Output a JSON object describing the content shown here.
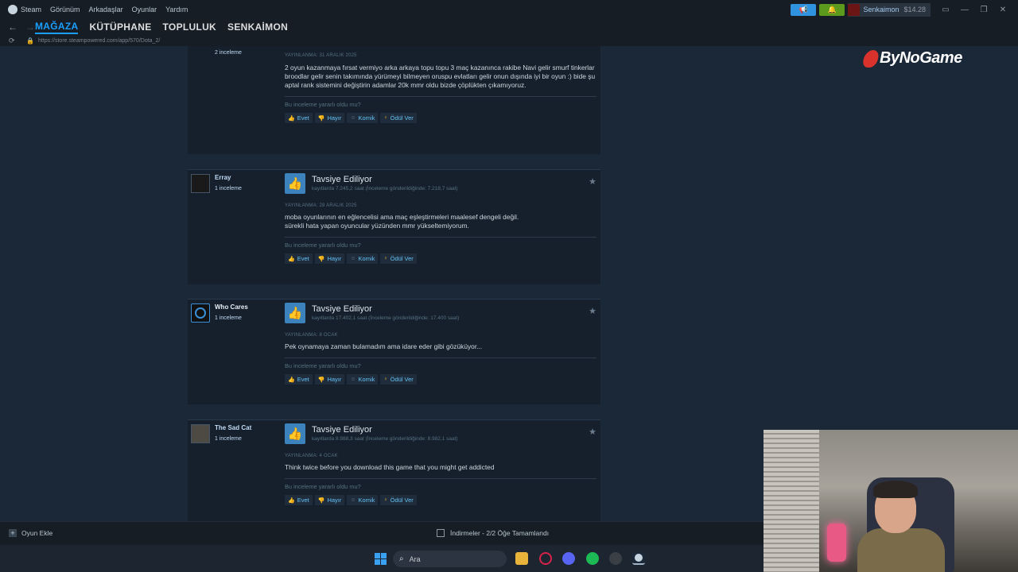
{
  "menu": {
    "items": [
      "Steam",
      "Görünüm",
      "Arkadaşlar",
      "Oyunlar",
      "Yardım"
    ]
  },
  "account": {
    "name": "Senkaimon",
    "balance": "$14.28"
  },
  "nav": {
    "tabs": [
      "MAĞAZA",
      "KÜTÜPHANE",
      "TOPLULUK",
      "SENKAİMON"
    ],
    "url": "https://store.steampowered.com/app/570/Dota_2/"
  },
  "brand": {
    "logo_text": "ByNoGame"
  },
  "reviews": [
    {
      "author": "",
      "count": "2 inceleme",
      "title": "",
      "hours": "",
      "posted": "YAYINLANMA: 31 ARALIK 2025",
      "text": "2 oyun kazanmaya fırsat vermiyo arka arkaya topu topu 3 maç kazanınca rakibe Navi gelir smurf tinkerlar broodlar gelir senin takımında yürümeyi bilmeyen oruspu evlatları gelir onun dışında iyi bir oyun :) bide şu aptal rank sistemini değiştirin adamlar 20k mmr oldu bizde çöplükten çıkamıyoruz."
    },
    {
      "author": "Erray",
      "count": "1 inceleme",
      "title": "Tavsiye Ediliyor",
      "hours": "kayıtlarda 7.245,2 saat (İnceleme gönderildiğinde: 7.218,7 saat)",
      "posted": "YAYINLANMA: 28 ARALIK 2025",
      "text": "moba oyunlarının en eğlencelisi ama maç eşleştirmeleri maalesef dengeli değil.\nsürekli hata yapan oyuncular yüzünden mmr yükseltemiyorum."
    },
    {
      "author": "Who Cares",
      "count": "1 inceleme",
      "title": "Tavsiye Ediliyor",
      "hours": "kayıtlarda 17.402,1 saat (İnceleme gönderildiğinde: 17.400 saat)",
      "posted": "YAYINLANMA: 8 OCAK",
      "text": "Pek oynamaya zaman bulamadım ama idare eder gibi gözüküyor..."
    },
    {
      "author": "The Sad Cat",
      "count": "1 inceleme",
      "title": "Tavsiye Ediliyor",
      "hours": "kayıtlarda 8.988,3 saat (İnceleme gönderildiğinde: 8.982,1 saat)",
      "posted": "YAYINLANMA: 4 OCAK",
      "text": "Think twice before you download this game that you might get addicted"
    }
  ],
  "review_common": {
    "helpful_q": "Bu inceleme yararlı oldu mu?",
    "yes": "Evet",
    "no": "Hayır",
    "funny": "Komik",
    "award": "Ödül Ver"
  },
  "bottom": {
    "add_game": "Oyun Ekle",
    "downloads": "İndirmeler - 2/2 Öğe Tamamlandı"
  },
  "taskbar": {
    "search_placeholder": "Ara"
  }
}
